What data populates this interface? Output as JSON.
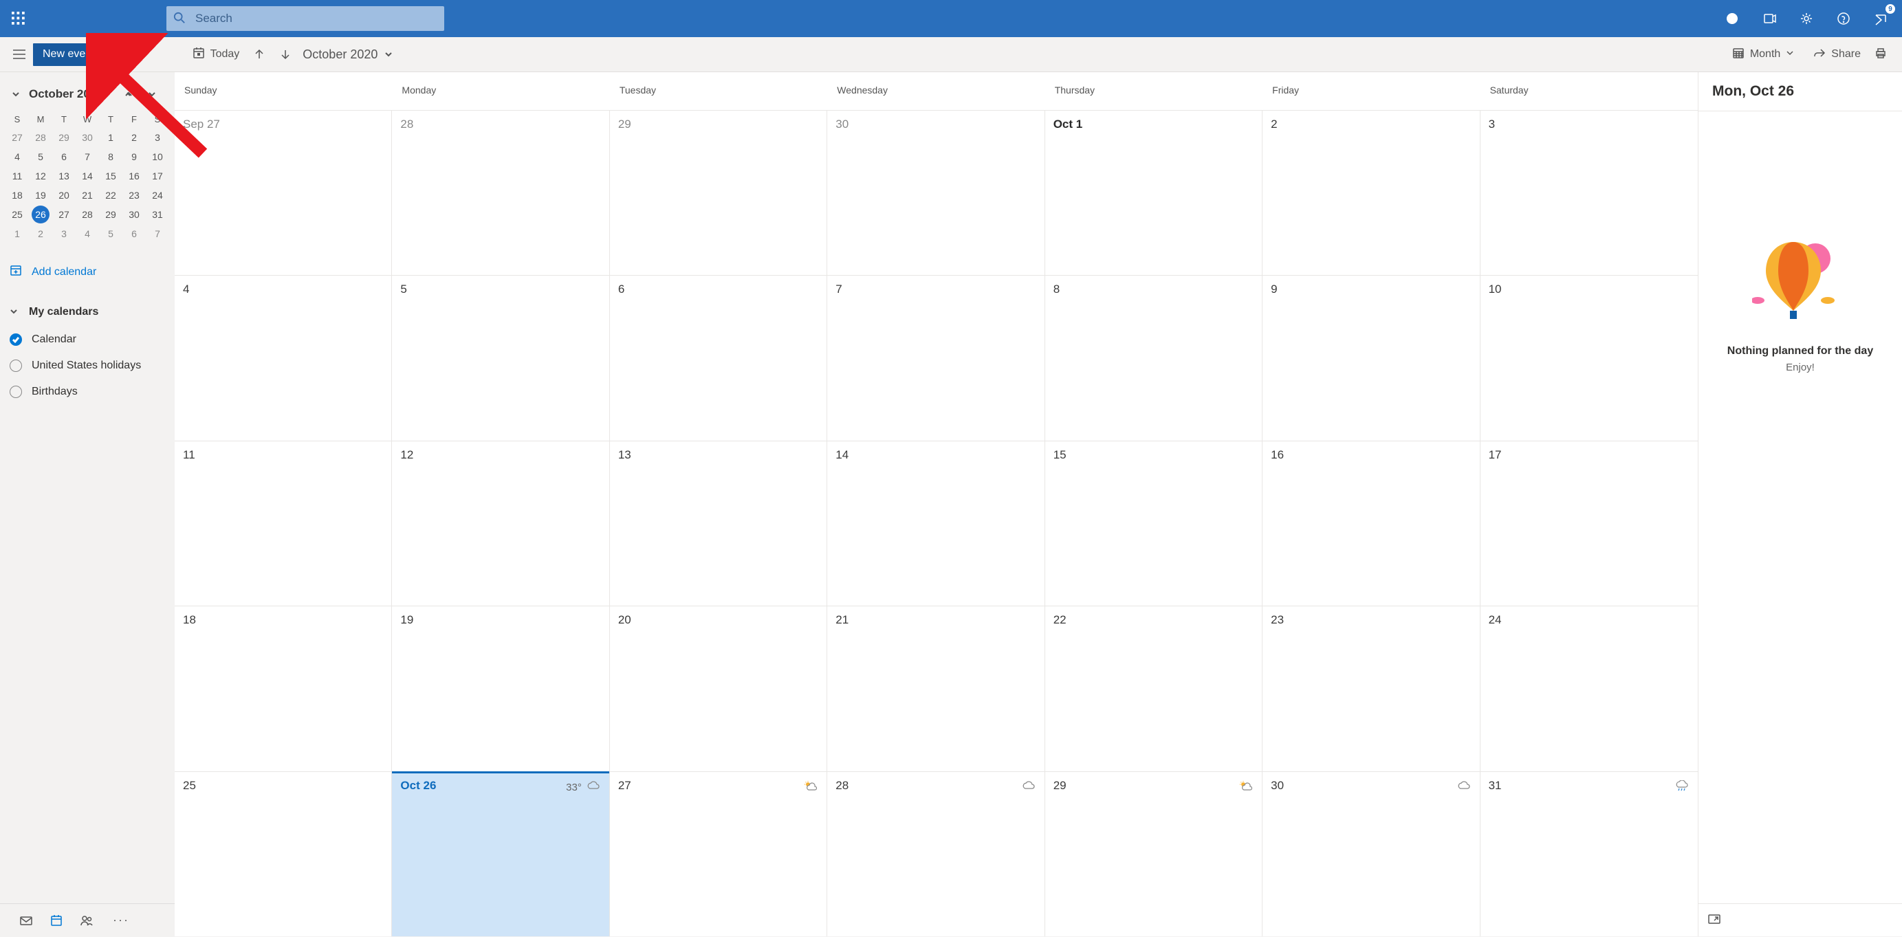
{
  "topbar": {
    "search_placeholder": "Search",
    "notification_count": "9"
  },
  "toolbar": {
    "new_event": "New event",
    "today": "Today",
    "month_year": "October 2020",
    "view": "Month",
    "share": "Share"
  },
  "sidebar": {
    "mini_month": "October 2020",
    "day_headers": [
      "S",
      "M",
      "T",
      "W",
      "T",
      "F",
      "S"
    ],
    "mini_days": [
      {
        "n": "27",
        "dim": true
      },
      {
        "n": "28",
        "dim": true
      },
      {
        "n": "29",
        "dim": true
      },
      {
        "n": "30",
        "dim": true
      },
      {
        "n": "1"
      },
      {
        "n": "2"
      },
      {
        "n": "3"
      },
      {
        "n": "4"
      },
      {
        "n": "5"
      },
      {
        "n": "6"
      },
      {
        "n": "7"
      },
      {
        "n": "8"
      },
      {
        "n": "9"
      },
      {
        "n": "10"
      },
      {
        "n": "11"
      },
      {
        "n": "12"
      },
      {
        "n": "13"
      },
      {
        "n": "14"
      },
      {
        "n": "15"
      },
      {
        "n": "16"
      },
      {
        "n": "17"
      },
      {
        "n": "18"
      },
      {
        "n": "19"
      },
      {
        "n": "20"
      },
      {
        "n": "21"
      },
      {
        "n": "22"
      },
      {
        "n": "23"
      },
      {
        "n": "24"
      },
      {
        "n": "25"
      },
      {
        "n": "26",
        "today": true
      },
      {
        "n": "27"
      },
      {
        "n": "28"
      },
      {
        "n": "29"
      },
      {
        "n": "30"
      },
      {
        "n": "31"
      },
      {
        "n": "1",
        "dim": true
      },
      {
        "n": "2",
        "dim": true
      },
      {
        "n": "3",
        "dim": true
      },
      {
        "n": "4",
        "dim": true
      },
      {
        "n": "5",
        "dim": true
      },
      {
        "n": "6",
        "dim": true
      },
      {
        "n": "7",
        "dim": true
      }
    ],
    "add_calendar": "Add calendar",
    "group_name": "My calendars",
    "calendars": [
      {
        "label": "Calendar",
        "on": true
      },
      {
        "label": "United States holidays",
        "on": false
      },
      {
        "label": "Birthdays",
        "on": false
      }
    ]
  },
  "calendar": {
    "day_headers": [
      "Sunday",
      "Monday",
      "Tuesday",
      "Wednesday",
      "Thursday",
      "Friday",
      "Saturday"
    ],
    "cells": [
      {
        "label": "Sep 27",
        "dim": true
      },
      {
        "label": "28",
        "dim": true
      },
      {
        "label": "29",
        "dim": true
      },
      {
        "label": "30",
        "dim": true
      },
      {
        "label": "Oct 1",
        "bold": true
      },
      {
        "label": "2"
      },
      {
        "label": "3"
      },
      {
        "label": "4"
      },
      {
        "label": "5"
      },
      {
        "label": "6"
      },
      {
        "label": "7"
      },
      {
        "label": "8"
      },
      {
        "label": "9"
      },
      {
        "label": "10"
      },
      {
        "label": "11"
      },
      {
        "label": "12"
      },
      {
        "label": "13"
      },
      {
        "label": "14"
      },
      {
        "label": "15"
      },
      {
        "label": "16"
      },
      {
        "label": "17"
      },
      {
        "label": "18"
      },
      {
        "label": "19"
      },
      {
        "label": "20"
      },
      {
        "label": "21"
      },
      {
        "label": "22"
      },
      {
        "label": "23"
      },
      {
        "label": "24"
      },
      {
        "label": "25"
      },
      {
        "label": "Oct 26",
        "today": true,
        "weather": "cloud",
        "temp": "33°"
      },
      {
        "label": "27",
        "weather": "partly"
      },
      {
        "label": "28",
        "weather": "cloud"
      },
      {
        "label": "29",
        "weather": "partly"
      },
      {
        "label": "30",
        "weather": "cloud"
      },
      {
        "label": "31",
        "weather": "rain"
      }
    ]
  },
  "agenda": {
    "date_title": "Mon, Oct 26",
    "empty_title": "Nothing planned for the day",
    "empty_sub": "Enjoy!"
  }
}
